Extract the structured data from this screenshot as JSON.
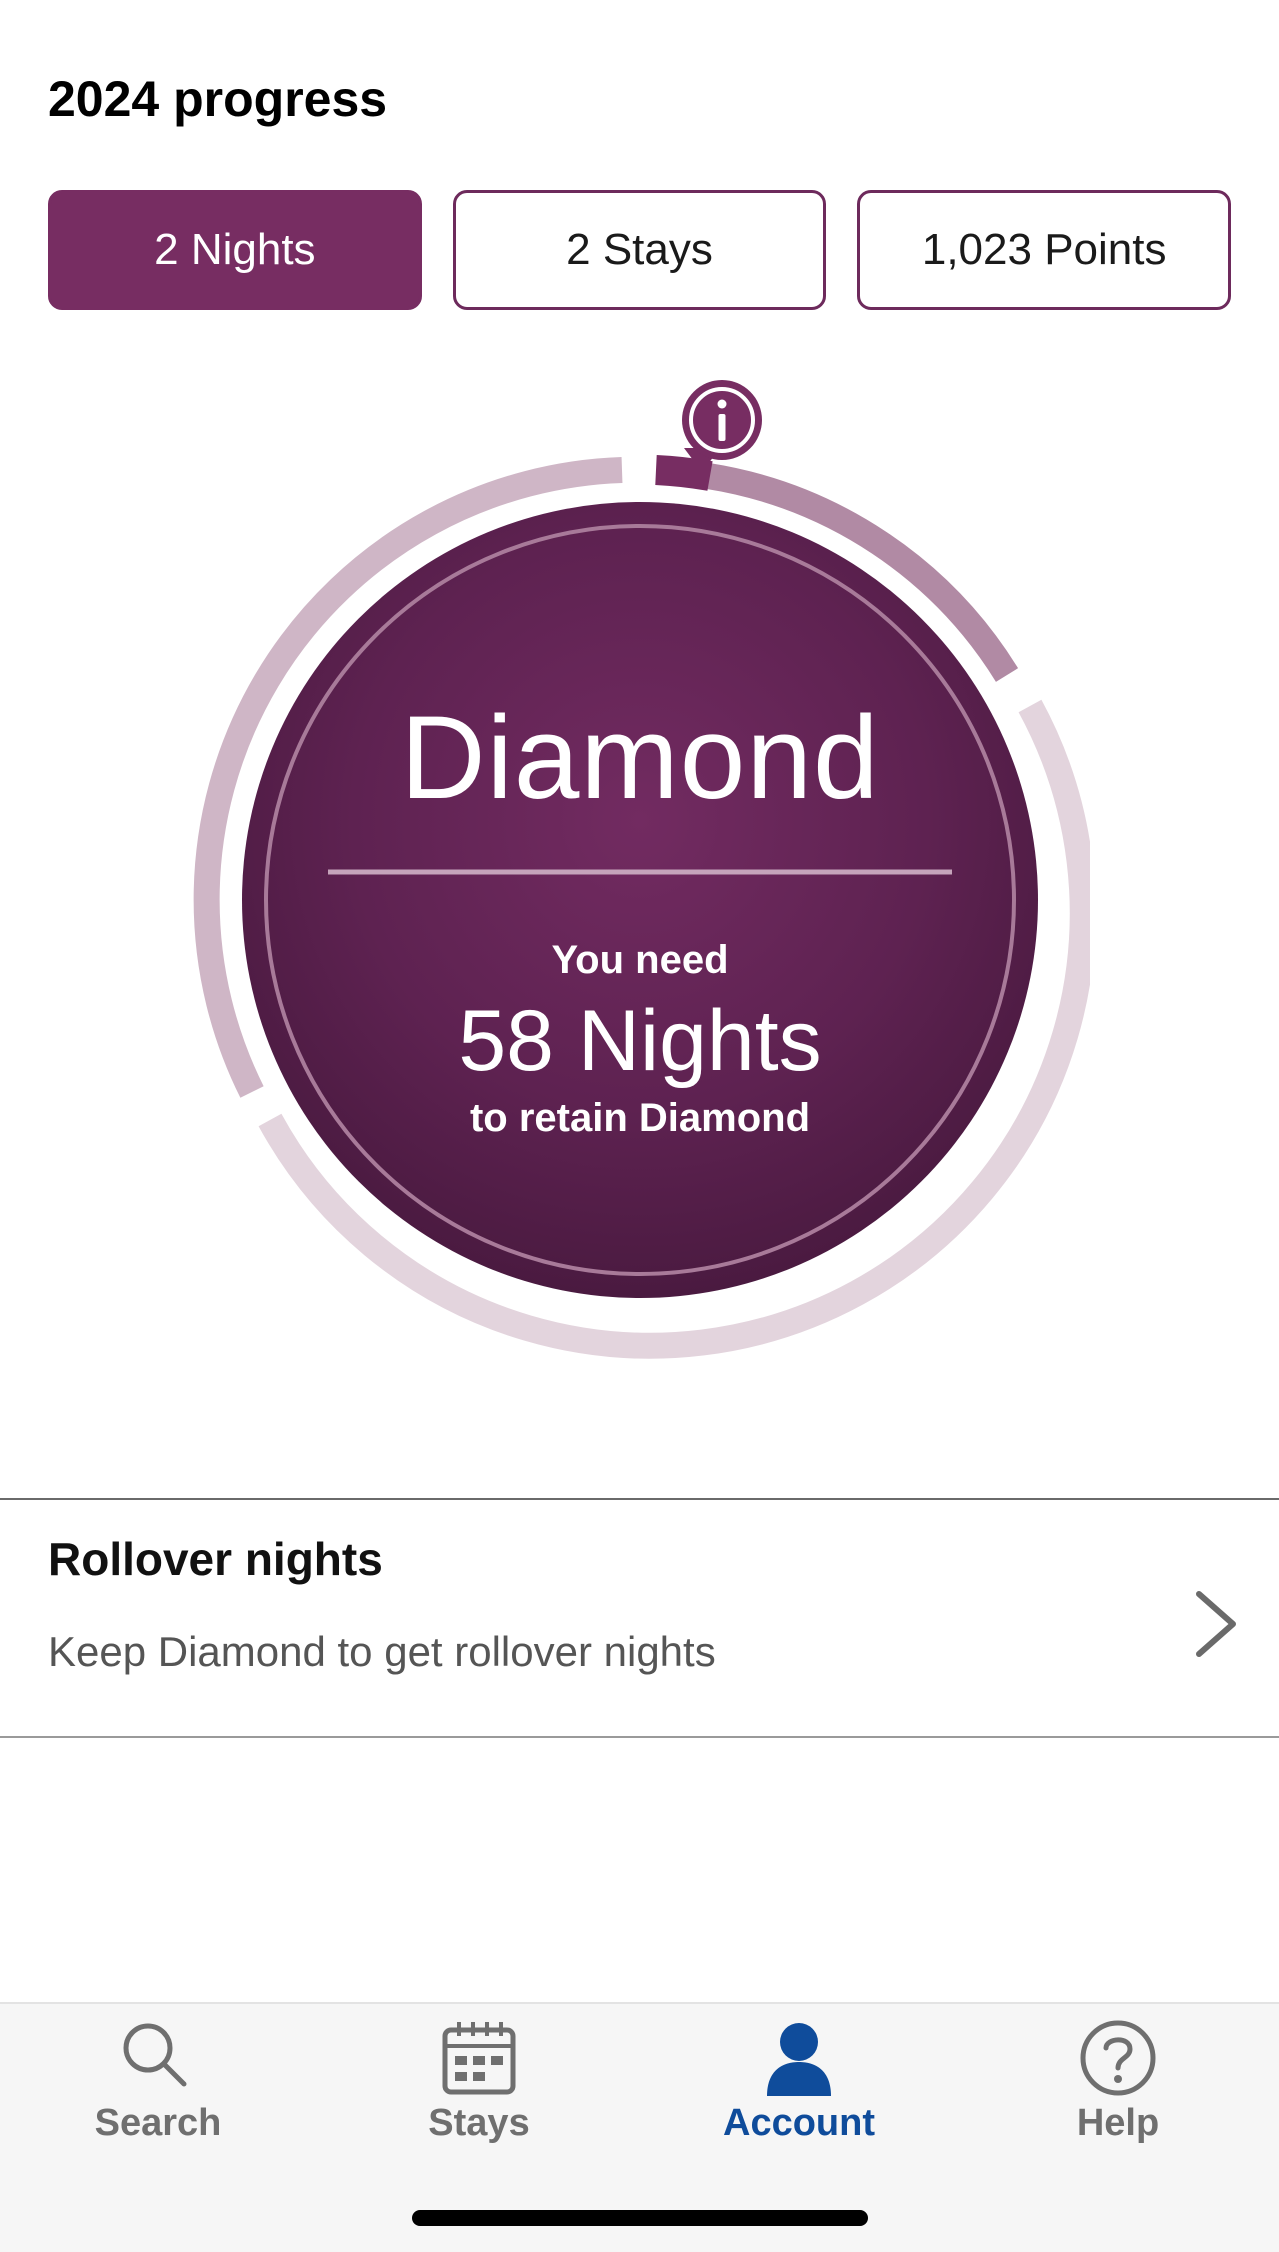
{
  "page": {
    "title": "2024 progress"
  },
  "tabs": [
    {
      "label": "2 Nights",
      "active": true
    },
    {
      "label": "2 Stays",
      "active": false
    },
    {
      "label": "1,023 Points",
      "active": false
    }
  ],
  "progress": {
    "tier": "Diamond",
    "need_label": "You need",
    "need_value": "58 Nights",
    "need_suffix": "to retain Diamond",
    "nights_completed_fraction": 0.033
  },
  "rollover": {
    "title": "Rollover nights",
    "subtitle": "Keep Diamond to get rollover nights"
  },
  "tabbar": {
    "items": [
      {
        "label": "Search",
        "icon": "search-icon",
        "active": false
      },
      {
        "label": "Stays",
        "icon": "calendar-icon",
        "active": false
      },
      {
        "label": "Account",
        "icon": "account-icon",
        "active": true
      },
      {
        "label": "Help",
        "icon": "help-icon",
        "active": false
      }
    ]
  },
  "colors": {
    "brand": "#772d62",
    "active_tab_text": "#0f4c9b",
    "inactive_tab_text": "#6f6f6f"
  }
}
